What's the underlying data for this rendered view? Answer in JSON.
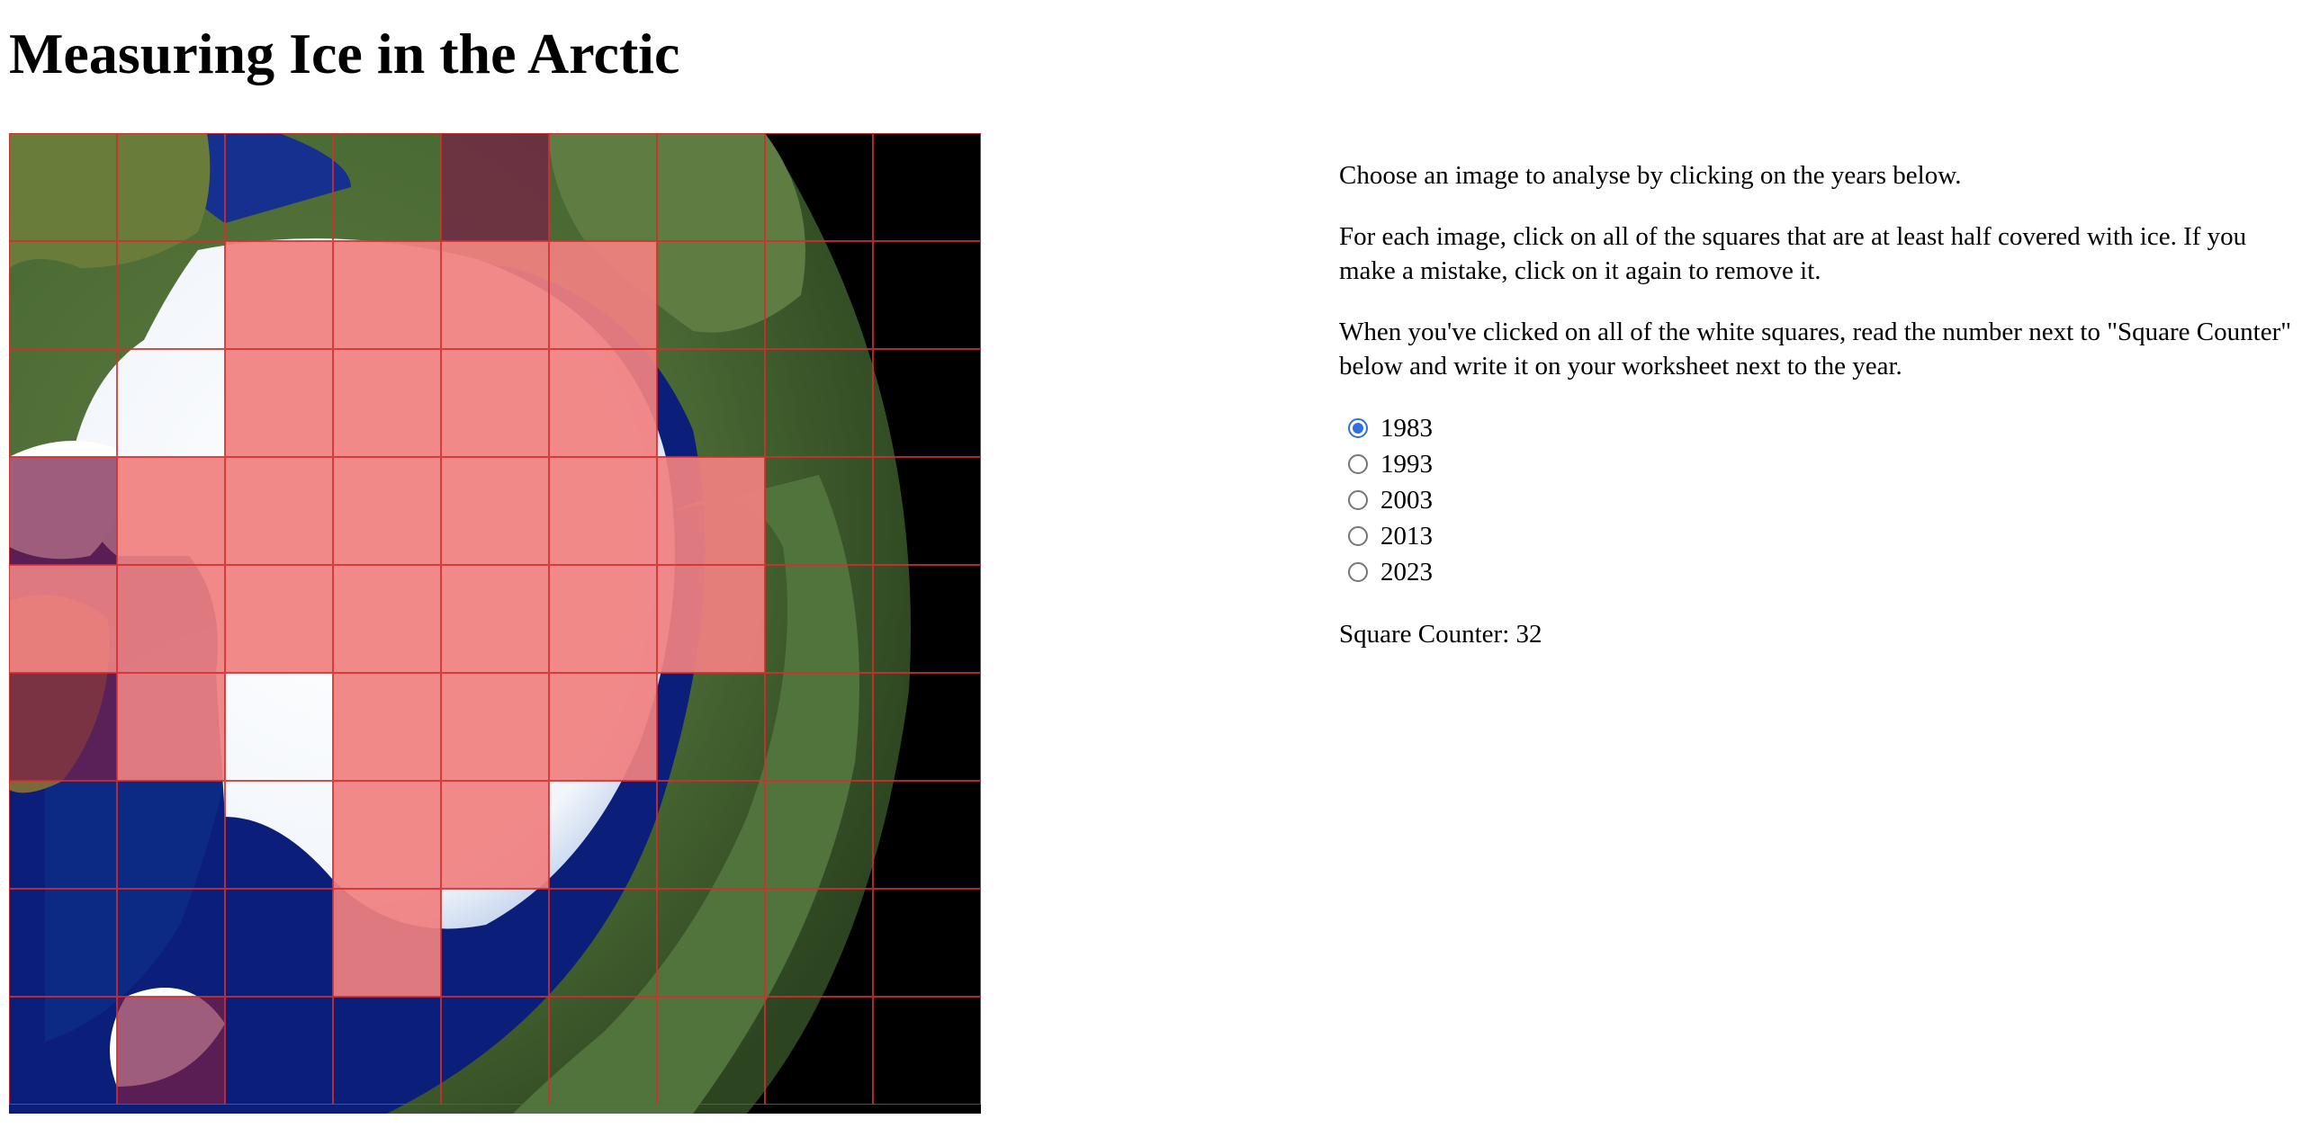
{
  "page": {
    "title": "Measuring Ice in the Arctic"
  },
  "instructions": [
    "Choose an image to analyse by clicking on the years below.",
    "For each image, click on all of the squares that are at least half covered with ice. If you make a mistake, click on it again to remove it.",
    "When you've clicked on all of the white squares, read the number next to \"Square Counter\" below and write it on your worksheet next to the year."
  ],
  "years": [
    {
      "label": "1983",
      "selected": true
    },
    {
      "label": "1993",
      "selected": false
    },
    {
      "label": "2003",
      "selected": false
    },
    {
      "label": "2013",
      "selected": false
    },
    {
      "label": "2023",
      "selected": false
    }
  ],
  "counter": {
    "label": "Square Counter: ",
    "value": "32"
  },
  "grid": {
    "rows": 9,
    "cols": 9,
    "selected_cells": [
      [
        1,
        2
      ],
      [
        1,
        3
      ],
      [
        1,
        4
      ],
      [
        1,
        5
      ],
      [
        2,
        2
      ],
      [
        2,
        3
      ],
      [
        2,
        4
      ],
      [
        2,
        5
      ],
      [
        3,
        1
      ],
      [
        3,
        2
      ],
      [
        3,
        3
      ],
      [
        3,
        4
      ],
      [
        3,
        5
      ],
      [
        3,
        6
      ],
      [
        4,
        0
      ],
      [
        4,
        1
      ],
      [
        4,
        2
      ],
      [
        4,
        3
      ],
      [
        4,
        4
      ],
      [
        4,
        5
      ],
      [
        4,
        6
      ],
      [
        5,
        0
      ],
      [
        5,
        1
      ],
      [
        5,
        3
      ],
      [
        5,
        4
      ],
      [
        5,
        5
      ],
      [
        6,
        3
      ],
      [
        6,
        4
      ],
      [
        7,
        3
      ],
      [
        8,
        1
      ],
      [
        0,
        4
      ],
      [
        3,
        0
      ]
    ]
  },
  "colors": {
    "grid_line": "#d62d2d",
    "selected_fill": "#f08080",
    "radio_accent": "#2f6fde"
  }
}
